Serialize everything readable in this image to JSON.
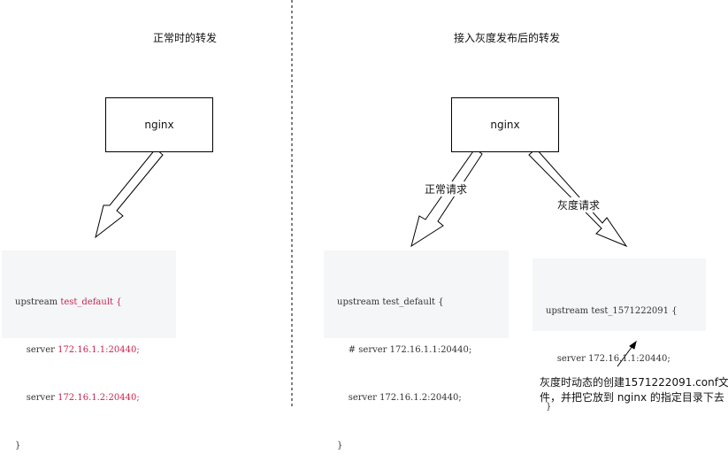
{
  "left": {
    "title": "正常时的转发",
    "nginx_label": "nginx",
    "code": {
      "line1_kw": "upstream ",
      "line1_name": "test_default {",
      "line2_kw": "    server ",
      "line2_val": "172.16.1.1:20440;",
      "line3_kw": "    server ",
      "line3_val": "172.16.1.2:20440;",
      "line4": "}"
    }
  },
  "right": {
    "title": "接入灰度发布后的转发",
    "nginx_label": "nginx",
    "edge_normal": "正常请求",
    "edge_gray": "灰度请求",
    "code_default": {
      "line1": "upstream test_default {",
      "line2": "    # server 172.16.1.1:20440;",
      "line3": "    server 172.16.1.2:20440;",
      "line4": "}"
    },
    "code_gray": {
      "line1": "upstream test_1571222091 {",
      "line2": "    server 172.16.1.1:20440;",
      "line3": "}"
    },
    "note": "灰度时动态的创建1571222091.conf文件，并把它放到 nginx 的指定目录下去"
  },
  "colors": {
    "highlight": "#c7254e",
    "code_bg": "#f5f6f7"
  }
}
